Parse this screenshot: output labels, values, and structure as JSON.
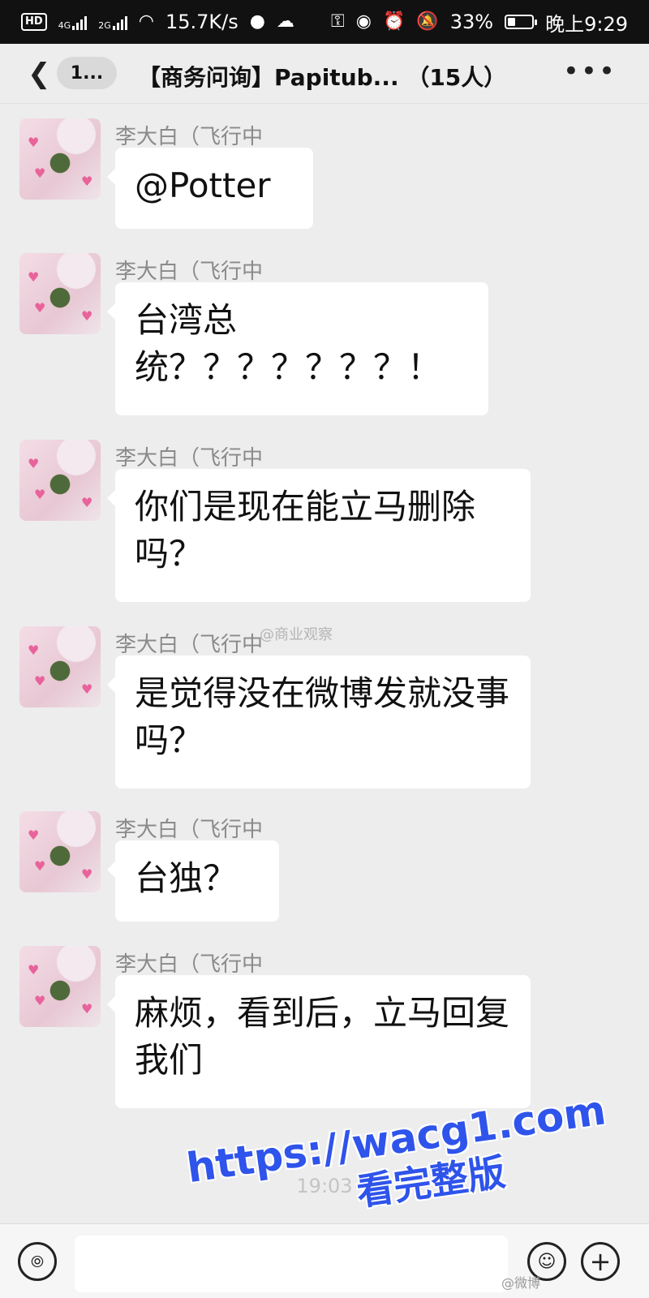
{
  "status_bar": {
    "badges": "HD",
    "net_4g": "4G",
    "net_2g": "2G",
    "speed": "15.7K/s",
    "battery": "33%",
    "time": "晚上9:29",
    "battery_level": 0.33
  },
  "nav": {
    "unread": "1...",
    "title": "【商务问询】Papitub...  （15人）",
    "back_icon": "chevron-left-icon",
    "more_icon": "more-icon"
  },
  "messages": [
    {
      "sender": "李大白（飞行中",
      "text": "@Potter"
    },
    {
      "sender": "李大白（飞行中",
      "text": "台湾总统？？？？？？？！"
    },
    {
      "sender": "李大白（飞行中",
      "text": "你们是现在能立马删除吗？"
    },
    {
      "sender": "李大白（飞行中",
      "text": "是觉得没在微博发就没事吗？"
    },
    {
      "sender": "李大白（飞行中",
      "text": "台独？"
    },
    {
      "sender": "李大白（飞行中",
      "text": "麻烦，看到后，立马回复我们"
    }
  ],
  "timestamp": "19:03",
  "watermarks": {
    "inline": "@商业观察",
    "url": "https://wacg1.com",
    "url_caption": "看完整版",
    "bottom": "@微博"
  },
  "input_bar": {
    "voice_icon": "voice-icon",
    "emoji_icon": "emoji-icon",
    "plus_icon": "plus-icon",
    "text_value": ""
  }
}
